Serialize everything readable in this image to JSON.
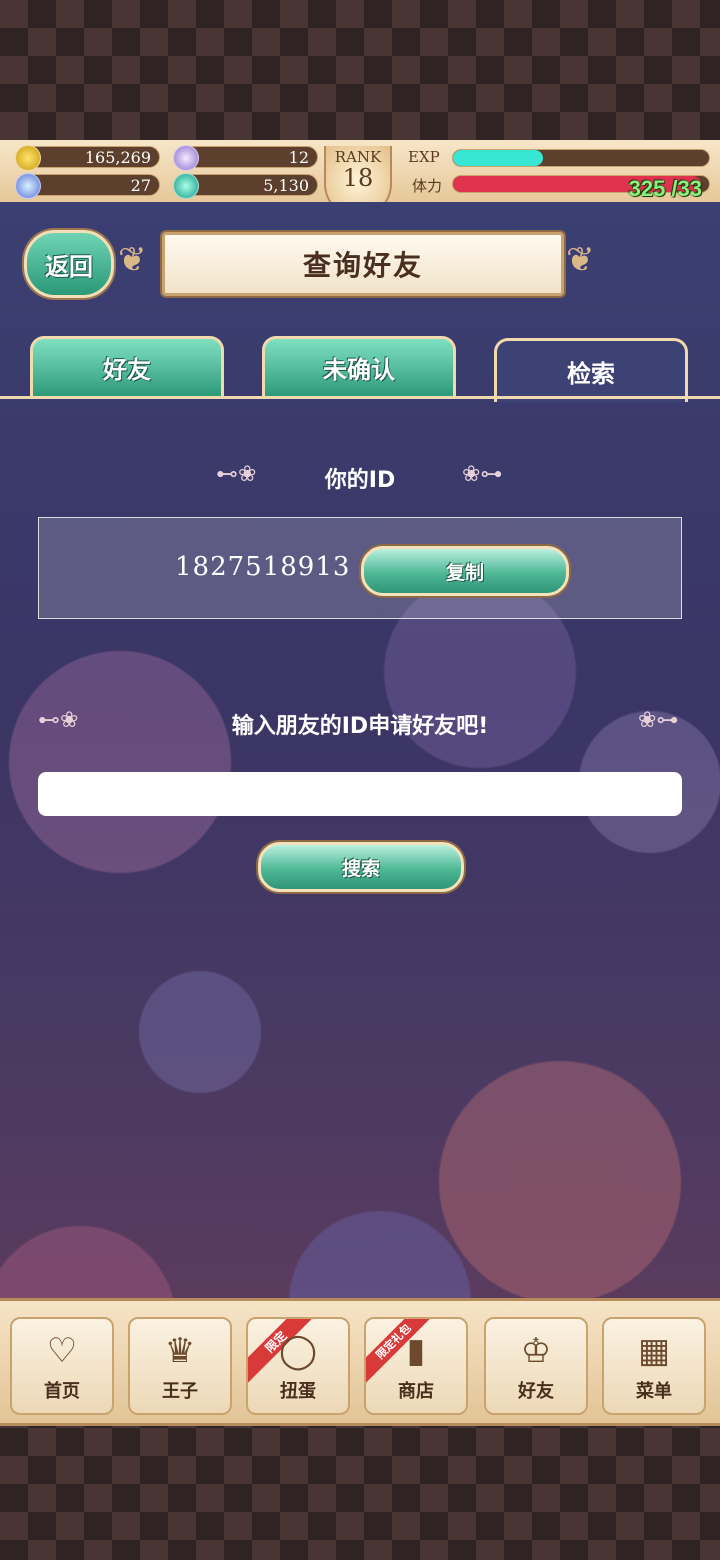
{
  "status": {
    "gold": "165,269",
    "gem_purple": "12",
    "crystal": "27",
    "coin_green": "5,130",
    "rank_label": "RANK",
    "rank_value": "18",
    "exp_label": "EXP",
    "exp_fraction": 0.35,
    "stamina_label": "体力",
    "stamina_text": "325 /33",
    "stamina_fraction": 0.97
  },
  "header": {
    "back_label": "返回",
    "title": "查询好友"
  },
  "tabs": [
    {
      "label": "好友",
      "active": false
    },
    {
      "label": "未确认",
      "active": false
    },
    {
      "label": "检索",
      "active": true
    }
  ],
  "my_id": {
    "section_title": "你的ID",
    "value": "1827518913",
    "copy_label": "复制"
  },
  "search": {
    "prompt": "输入朋友的ID申请好友吧!",
    "input_value": "",
    "button_label": "搜索"
  },
  "bottom_nav": [
    {
      "label": "首页",
      "icon": "heart-icon",
      "ribbon": ""
    },
    {
      "label": "王子",
      "icon": "crown-icon",
      "ribbon": ""
    },
    {
      "label": "扭蛋",
      "icon": "ring-icon",
      "ribbon": "限定"
    },
    {
      "label": "商店",
      "icon": "bag-icon",
      "ribbon": "限定礼包"
    },
    {
      "label": "好友",
      "icon": "tiara-icon",
      "ribbon": ""
    },
    {
      "label": "菜单",
      "icon": "grid-icon",
      "ribbon": ""
    }
  ],
  "colors": {
    "accent_green": "#2d9a79",
    "exp_cyan": "#38e6d4",
    "stamina_red": "#e0334d"
  }
}
